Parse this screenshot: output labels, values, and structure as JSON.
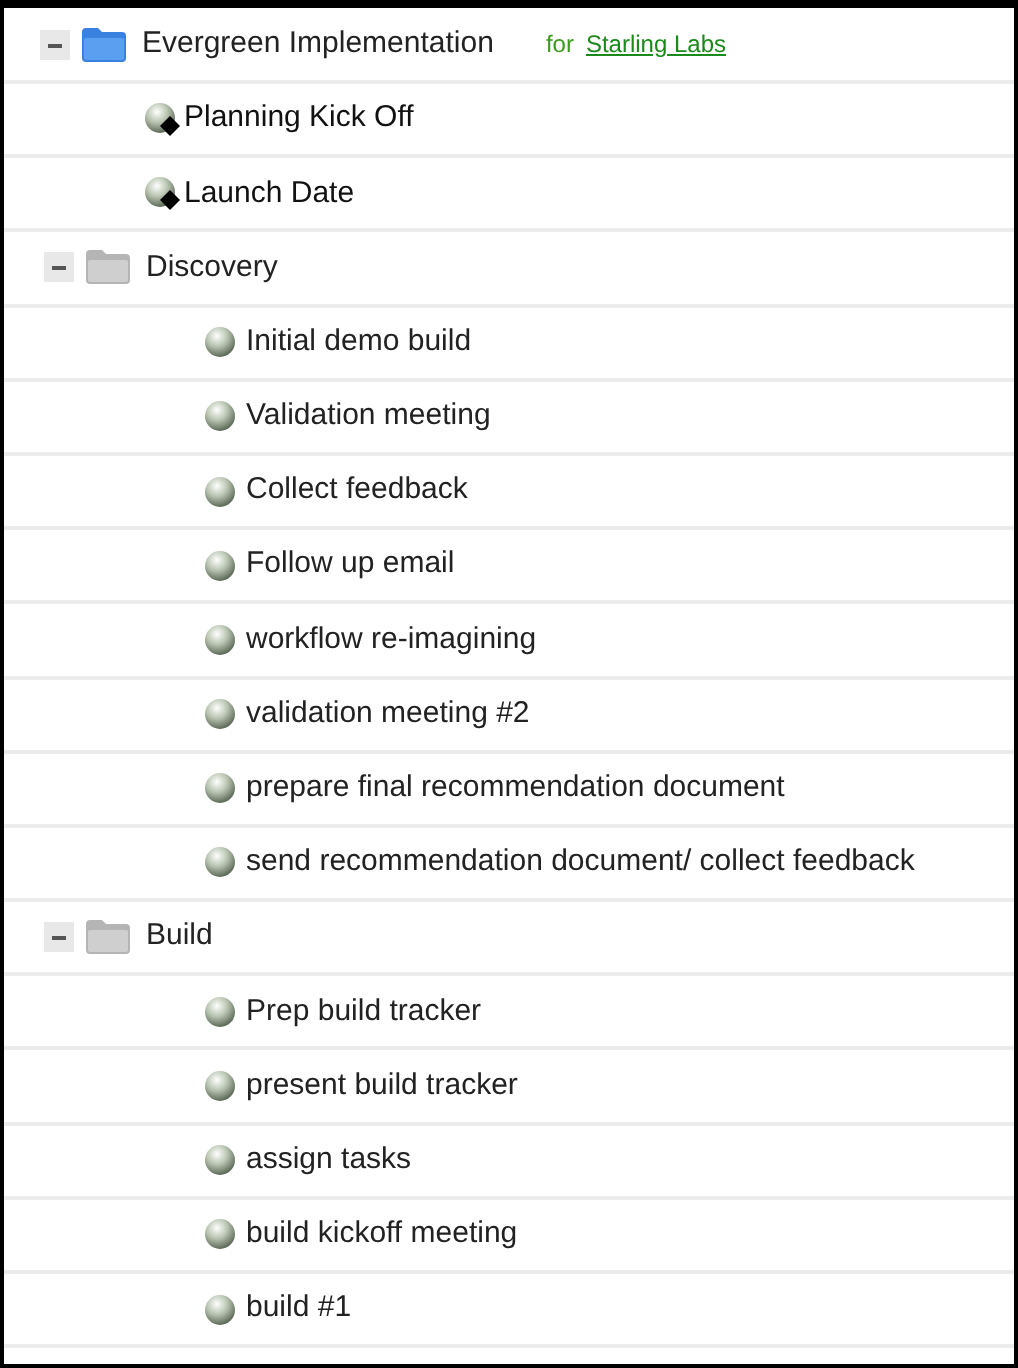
{
  "project": {
    "name": "Evergreen Implementation",
    "client_prefix": "for",
    "client": "Starling Labs",
    "expanded": true,
    "children": [
      {
        "kind": "milestone",
        "name": "Planning Kick Off"
      },
      {
        "kind": "milestone",
        "name": "Launch Date"
      },
      {
        "kind": "folder",
        "name": "Discovery",
        "expanded": true,
        "children": [
          {
            "kind": "task",
            "name": "Initial demo build"
          },
          {
            "kind": "task",
            "name": "Validation meeting"
          },
          {
            "kind": "task",
            "name": "Collect feedback"
          },
          {
            "kind": "task",
            "name": "Follow up email"
          },
          {
            "kind": "task",
            "name": "workflow re-imagining"
          },
          {
            "kind": "task",
            "name": "validation meeting #2"
          },
          {
            "kind": "task",
            "name": "prepare final recommendation document"
          },
          {
            "kind": "task",
            "name": "send recommendation document/ collect feedback"
          }
        ]
      },
      {
        "kind": "folder",
        "name": "Build",
        "expanded": true,
        "children": [
          {
            "kind": "task",
            "name": "Prep build tracker"
          },
          {
            "kind": "task",
            "name": "present build tracker"
          },
          {
            "kind": "task",
            "name": "assign tasks"
          },
          {
            "kind": "task",
            "name": "build kickoff meeting"
          },
          {
            "kind": "task",
            "name": "build #1"
          }
        ]
      }
    ]
  }
}
